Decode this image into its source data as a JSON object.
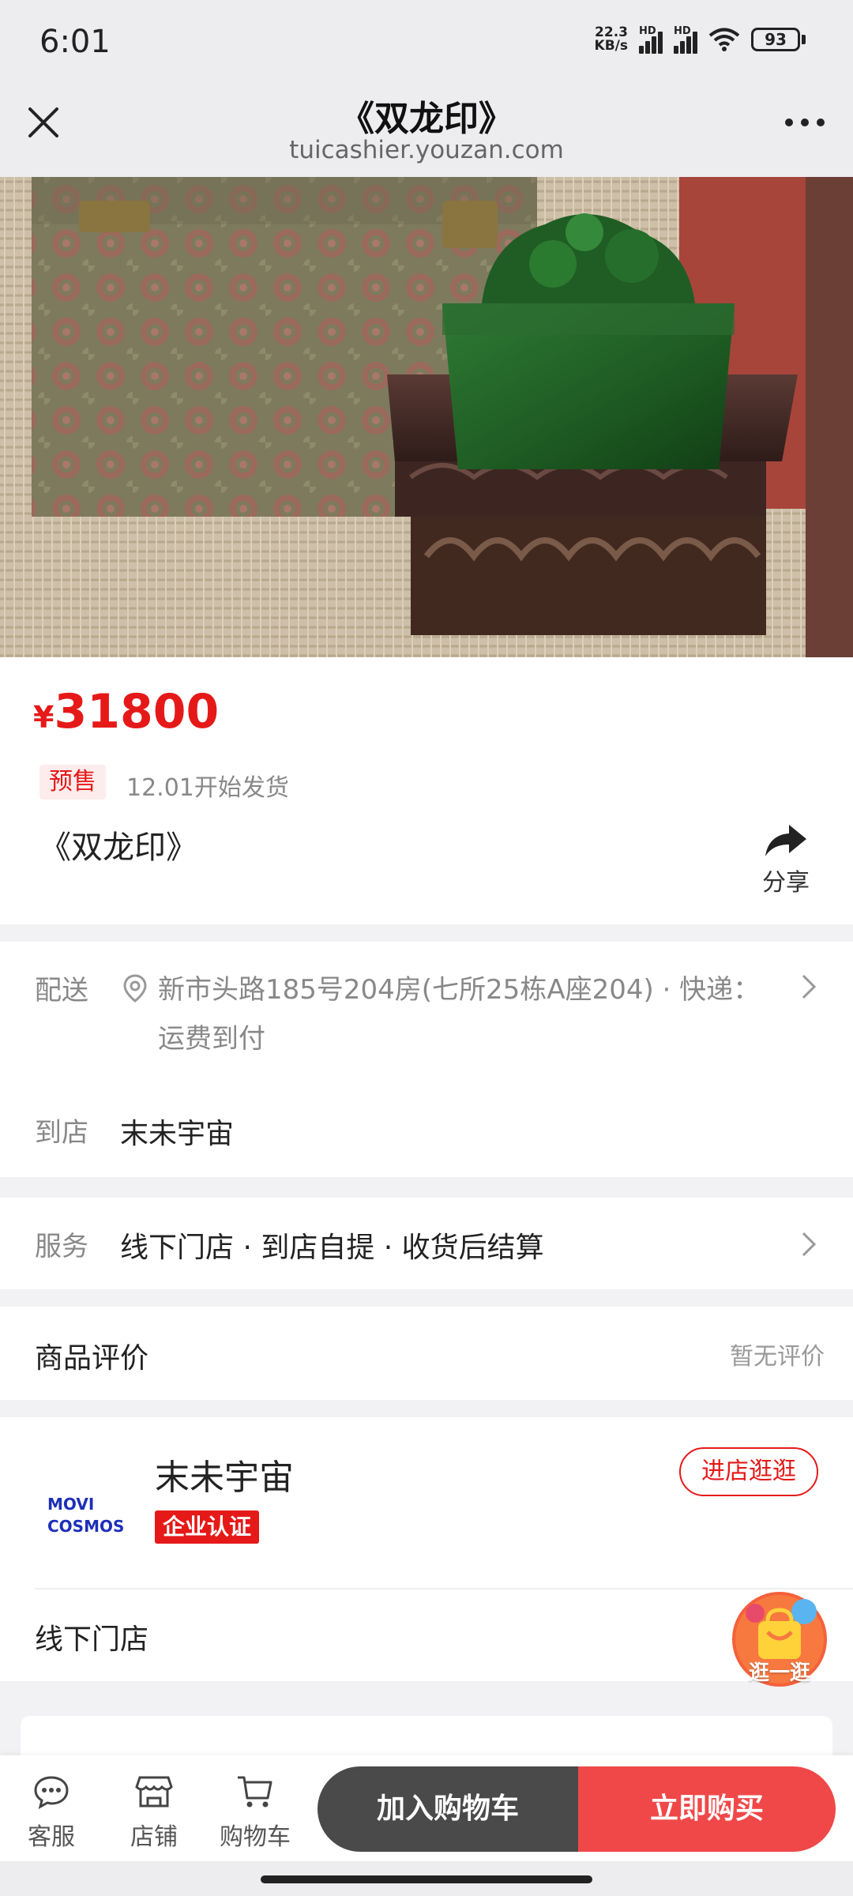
{
  "status_bar": {
    "time": "6:01",
    "net_speed_value": "22.3",
    "net_speed_unit": "KB/s",
    "hd_label": "HD",
    "battery": "93"
  },
  "header": {
    "title": "《双龙印》",
    "url": "tuicashier.youzan.com"
  },
  "product": {
    "currency": "¥",
    "price": "31800",
    "presale_tag": "预售",
    "ship_note": "12.01开始发货",
    "title": "《双龙印》",
    "share_label": "分享"
  },
  "delivery": {
    "label": "配送",
    "address": "新市头路185号204房(七所25栋A座204) · 快递：运费到付",
    "store_label": "到店",
    "store_name": "末未宇宙"
  },
  "service": {
    "label": "服务",
    "text": "线下门店 · 到店自提 · 收货后结算"
  },
  "review": {
    "title": "商品评价",
    "status": "暂无评价"
  },
  "shop": {
    "logo_line1": "MOVI",
    "logo_line2": "COSMOS",
    "name": "末未宇宙",
    "cert": "企业认证",
    "enter_label": "进店逛逛",
    "offline_title": "线下门店"
  },
  "float_button": {
    "label": "逛一逛"
  },
  "bottom_bar": {
    "service_label": "客服",
    "store_label": "店铺",
    "cart_label": "购物车",
    "add_cart_label": "加入购物车",
    "buy_label": "立即购买"
  },
  "colors": {
    "accent_red": "#e61919",
    "buy_red": "#f04848",
    "cart_dark": "#4a4a4a"
  }
}
